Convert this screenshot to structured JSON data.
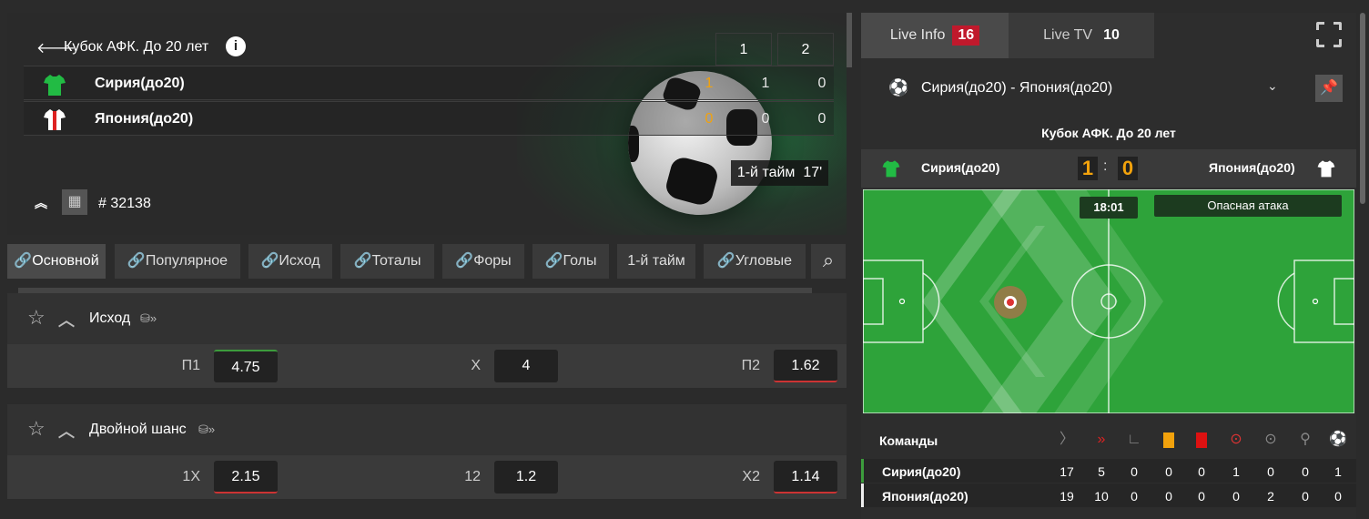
{
  "header": {
    "back_icon": "arrow-left-icon",
    "tournament": "Кубок АФК. До 20 лет",
    "period_headers": [
      "1",
      "2"
    ],
    "teams": [
      {
        "name": "Сирия(до20)",
        "total": "1",
        "p1": "1",
        "p2": "0",
        "jersey_color": "#22bb44"
      },
      {
        "name": "Япония(до20)",
        "total": "0",
        "p1": "0",
        "p2": "0",
        "jersey_color": "#ffffff"
      }
    ],
    "period": "1-й тайм",
    "minute": "17'",
    "match_number": "# 32138"
  },
  "tabs": [
    "Основной",
    "Популярное",
    "Исход",
    "Тоталы",
    "Форы",
    "Голы",
    "1-й тайм",
    "Угловые"
  ],
  "markets": [
    {
      "title": "Исход",
      "odds": [
        {
          "label": "П1",
          "value": "4.75"
        },
        {
          "label": "X",
          "value": "4"
        },
        {
          "label": "П2",
          "value": "1.62"
        }
      ]
    },
    {
      "title": "Двойной шанс",
      "odds": [
        {
          "label": "1X",
          "value": "2.15"
        },
        {
          "label": "12",
          "value": "1.2"
        },
        {
          "label": "X2",
          "value": "1.14"
        }
      ]
    }
  ],
  "right": {
    "live_info_label": "Live Info",
    "live_info_count": "16",
    "live_tv_label": "Live TV",
    "live_tv_count": "10",
    "match_select": "Сирия(до20) - Япония(до20)",
    "tournament": "Кубок АФК. До 20 лет",
    "home": "Сирия(до20)",
    "away": "Япония(до20)",
    "home_score": "1",
    "away_score": "0",
    "score_sep": ":",
    "clock": "18:01",
    "event": "Опасная атака",
    "stats": {
      "header": "Команды",
      "icons": [
        "attack-icon",
        "dangerous-attack-icon",
        "corner-icon",
        "yellow-card-icon",
        "red-card-icon",
        "shot-on-target-icon",
        "shot-off-target-icon",
        "penalty-icon",
        "goal-icon"
      ],
      "rows": [
        {
          "team": "Сирия(до20)",
          "values": [
            "17",
            "5",
            "0",
            "0",
            "0",
            "1",
            "0",
            "0",
            "1"
          ]
        },
        {
          "team": "Япония(до20)",
          "values": [
            "19",
            "10",
            "0",
            "0",
            "0",
            "0",
            "2",
            "0",
            "0"
          ]
        }
      ]
    }
  },
  "colors": {
    "accent_orange": "#f2a20c",
    "live_red": "#c0192c",
    "pitch_green": "#2ea33a"
  }
}
